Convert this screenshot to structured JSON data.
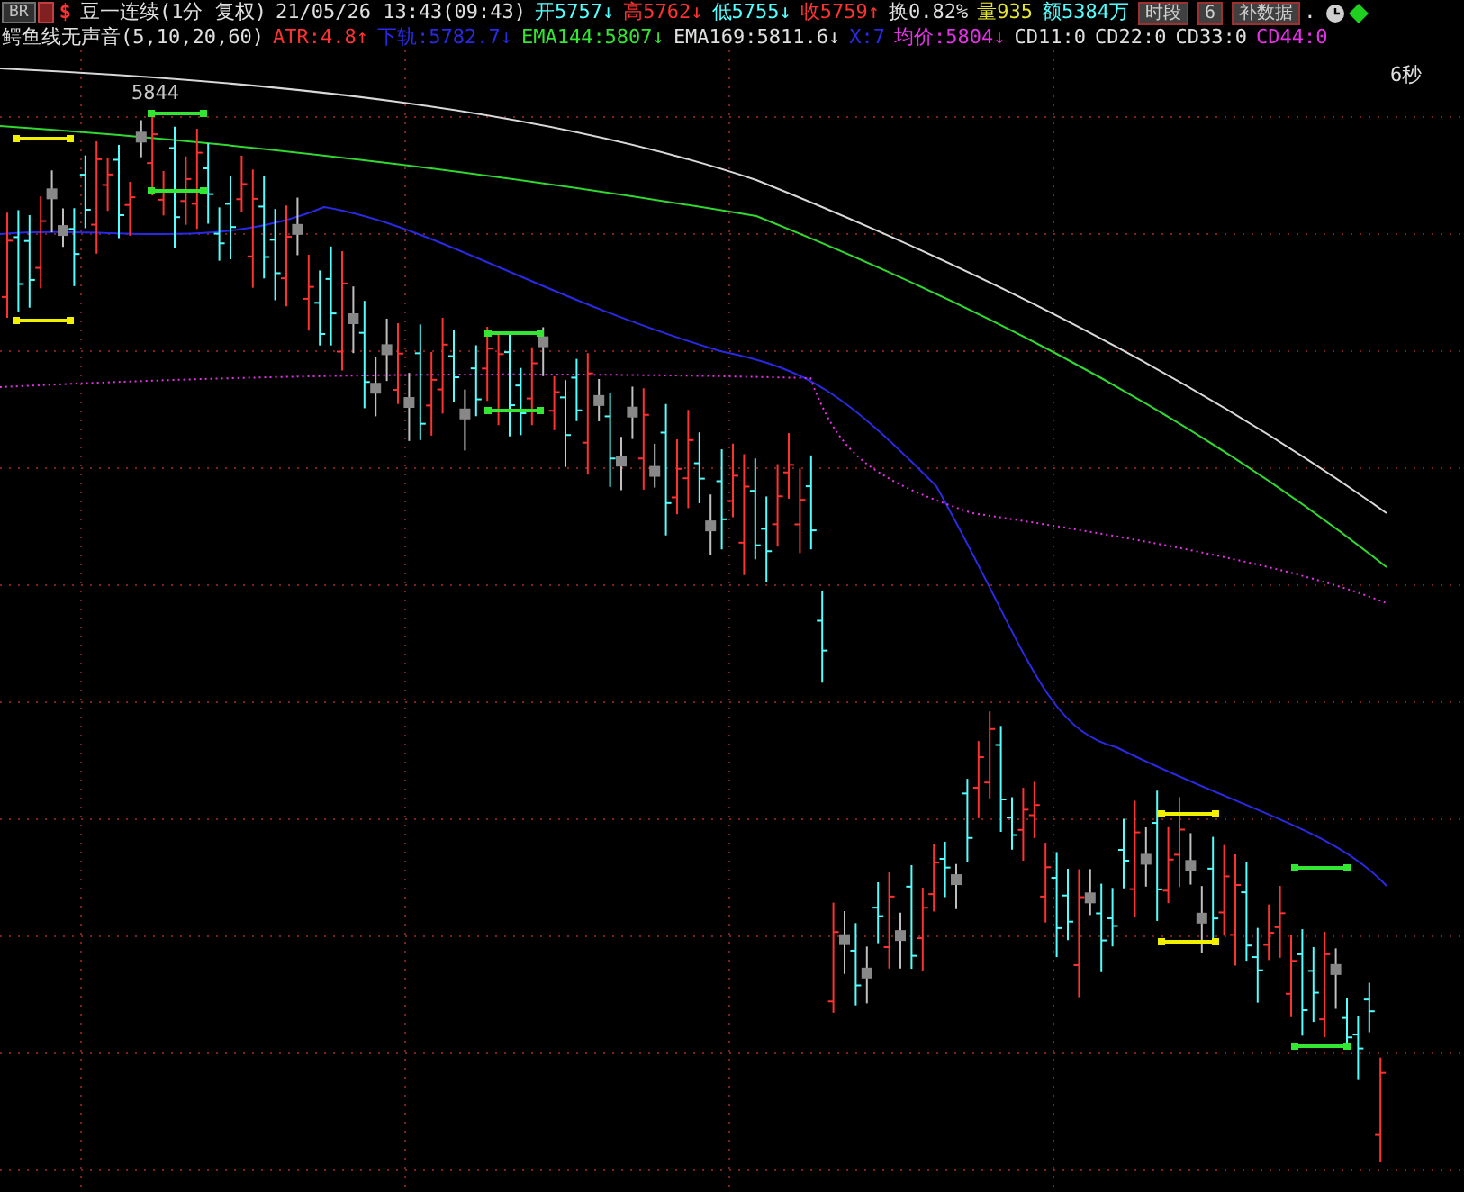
{
  "header": {
    "menu_button": "BR",
    "currency": "$",
    "symbol": "豆一连续(1分 复权)",
    "datetime": "21/05/26 13:43(09:43)",
    "quotes": [
      {
        "text": "开5757↓",
        "color": "#54ffff"
      },
      {
        "text": "高5762↓",
        "color": "#ff3232"
      },
      {
        "text": "低5755↓",
        "color": "#54ffff"
      },
      {
        "text": "收5759↑",
        "color": "#ff3232"
      },
      {
        "text": "换0.82%",
        "color": "#e0e0e0"
      },
      {
        "text": "量935",
        "color": "#e6e632"
      },
      {
        "text": "额5384万",
        "color": "#54ffff"
      }
    ],
    "buttons": [
      "时段",
      "6",
      "补数据"
    ],
    "trailing": "."
  },
  "indicators": {
    "name": "鳄鱼线无声音(5,10,20,60)",
    "values": [
      {
        "text": "ATR:4.8↑",
        "color": "#ff3232"
      },
      {
        "text": "下轨:5782.7↓",
        "color": "#2a2ae6"
      },
      {
        "text": "EMA144:5807↓",
        "color": "#32e632"
      },
      {
        "text": "EMA169:5811.6↓",
        "color": "#e0e0e0"
      },
      {
        "text": "X:7",
        "color": "#2a2ae6"
      },
      {
        "text": "均价:5804↓",
        "color": "#e632e6"
      },
      {
        "text": "CD11:0",
        "color": "#e0e0e0"
      },
      {
        "text": "CD22:0",
        "color": "#e0e0e0"
      },
      {
        "text": "CD33:0",
        "color": "#e0e0e0"
      },
      {
        "text": "CD44:0",
        "color": "#e632e6"
      }
    ]
  },
  "chart": {
    "price_label": "5844",
    "timer": "6秒"
  }
}
